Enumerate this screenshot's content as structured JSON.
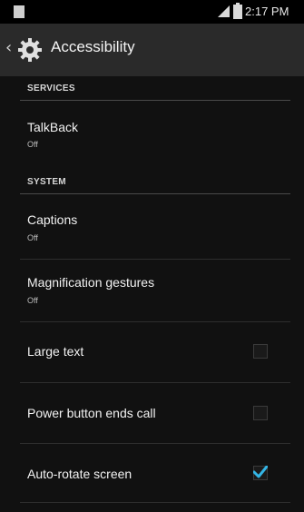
{
  "status_bar": {
    "time": "2:17 PM",
    "left_icon": "notification-icon",
    "signal_icon": "signal-icon",
    "battery_icon": "battery-icon"
  },
  "action_bar": {
    "title": "Accessibility",
    "back_icon": "chevron-left-icon",
    "app_icon": "gear-icon"
  },
  "sections": {
    "services_header": "SERVICES",
    "system_header": "SYSTEM"
  },
  "items": {
    "talkback": {
      "title": "TalkBack",
      "subtitle": "Off"
    },
    "captions": {
      "title": "Captions",
      "subtitle": "Off"
    },
    "magnification": {
      "title": "Magnification gestures",
      "subtitle": "Off"
    },
    "large_text": {
      "title": "Large text",
      "checked": false
    },
    "power_button": {
      "title": "Power button ends call",
      "checked": false
    },
    "auto_rotate": {
      "title": "Auto-rotate screen",
      "checked": true
    }
  },
  "colors": {
    "accent": "#33b5e5",
    "background": "#111111",
    "action_bar": "#2a2a2a"
  }
}
